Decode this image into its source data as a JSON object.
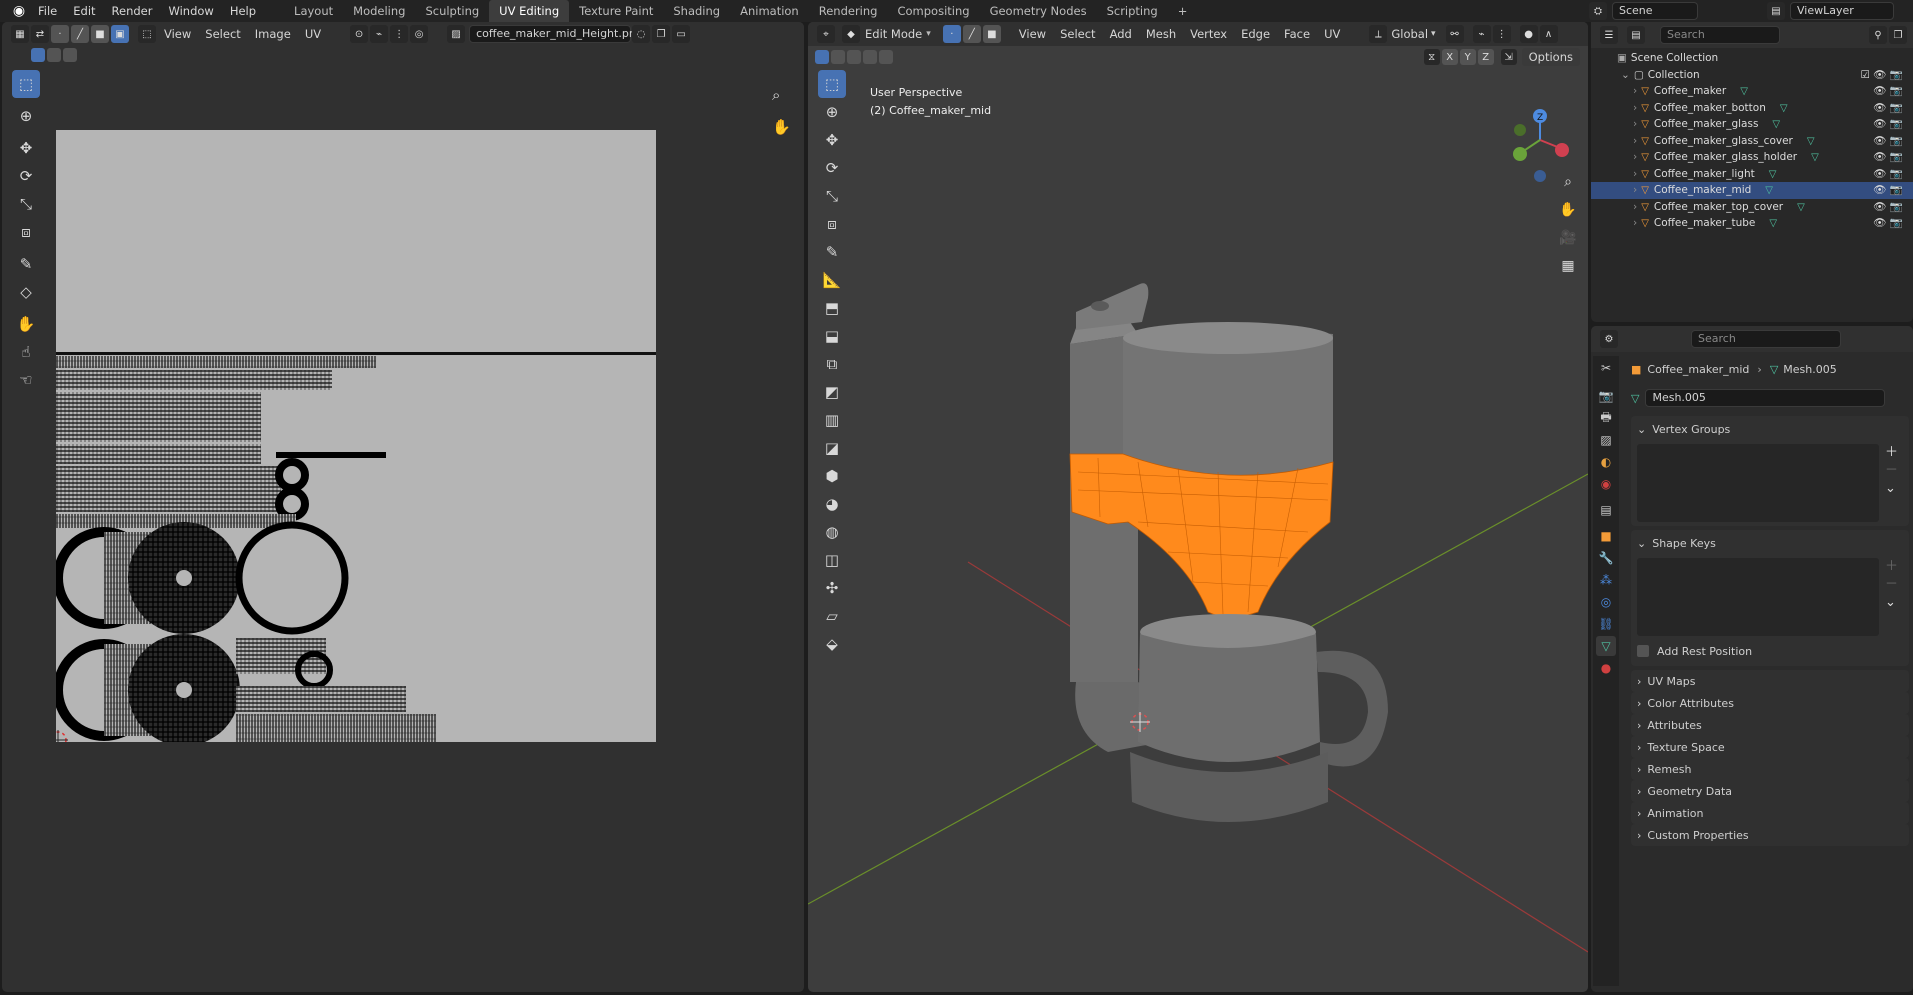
{
  "topbar": {
    "menus": [
      "File",
      "Edit",
      "Render",
      "Window",
      "Help"
    ],
    "workspaces": [
      "Layout",
      "Modeling",
      "Sculpting",
      "UV Editing",
      "Texture Paint",
      "Shading",
      "Animation",
      "Rendering",
      "Compositing",
      "Geometry Nodes",
      "Scripting"
    ],
    "active_workspace": "UV Editing",
    "add_tab": "+",
    "scene_label": "Scene",
    "view_layer_label": "ViewLayer"
  },
  "uv_editor": {
    "menus": [
      "View",
      "Select",
      "Image",
      "UV"
    ],
    "image_name": "coffee_maker_mid_Height.png"
  },
  "viewport": {
    "mode": "Edit Mode",
    "menus": [
      "View",
      "Select",
      "Add",
      "Mesh",
      "Vertex",
      "Edge",
      "Face",
      "UV"
    ],
    "transform_orientation": "Global",
    "axes": [
      "X",
      "Y",
      "Z"
    ],
    "options_label": "Options",
    "overlay_line1": "User Perspective",
    "overlay_line2": "(2) Coffee_maker_mid",
    "gizmo_axis_label": "Z"
  },
  "outliner": {
    "search_placeholder": "Search",
    "scene_collection": "Scene Collection",
    "collection": "Collection",
    "items": [
      {
        "name": "Coffee_maker",
        "selected": false
      },
      {
        "name": "Coffee_maker_botton",
        "selected": false
      },
      {
        "name": "Coffee_maker_glass",
        "selected": false
      },
      {
        "name": "Coffee_maker_glass_cover",
        "selected": false
      },
      {
        "name": "Coffee_maker_glass_holder",
        "selected": false
      },
      {
        "name": "Coffee_maker_light",
        "selected": false
      },
      {
        "name": "Coffee_maker_mid",
        "selected": true
      },
      {
        "name": "Coffee_maker_top_cover",
        "selected": false
      },
      {
        "name": "Coffee_maker_tube",
        "selected": false
      }
    ]
  },
  "properties": {
    "search_placeholder": "Search",
    "breadcrumb_object": "Coffee_maker_mid",
    "breadcrumb_mesh": "Mesh.005",
    "mesh_name": "Mesh.005",
    "vertex_groups": "Vertex Groups",
    "shape_keys": "Shape Keys",
    "add_rest_position": "Add Rest Position",
    "panels": [
      "UV Maps",
      "Color Attributes",
      "Attributes",
      "Texture Space",
      "Remesh",
      "Geometry Data",
      "Animation",
      "Custom Properties"
    ]
  },
  "colors": {
    "accent": "#4772b3",
    "selection_orange": "#ff8a1c",
    "selected_row": "#334d80",
    "mesh_icon": "#4fc3a1",
    "object_icon": "#f39b38"
  }
}
